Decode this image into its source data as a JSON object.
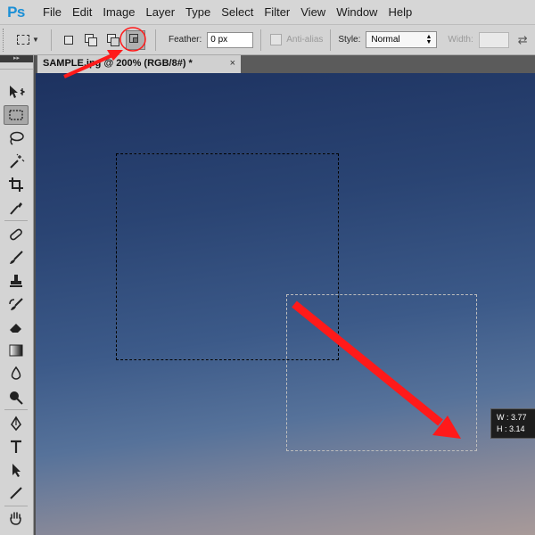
{
  "app": {
    "logo": "Ps"
  },
  "menu": [
    "File",
    "Edit",
    "Image",
    "Layer",
    "Type",
    "Select",
    "Filter",
    "View",
    "Window",
    "Help"
  ],
  "options": {
    "preset_icon": "rectangular-marquee-icon",
    "mode_buttons": [
      "new-selection-icon",
      "add-to-selection-icon",
      "subtract-from-selection-icon",
      "intersect-with-selection-icon"
    ],
    "active_mode": "intersect-with-selection-icon",
    "feather_label": "Feather:",
    "feather_value": "0 px",
    "antialias_label": "Anti-alias",
    "style_label": "Style:",
    "style_value": "Normal",
    "width_label": "Width:"
  },
  "document": {
    "tab_title": "SAMPLE.jpg @ 200% (RGB/8#) *",
    "close_glyph": "×"
  },
  "tooltip": {
    "w": "W :  3.77",
    "h": "H :  3.14"
  },
  "tools": [
    "move-icon",
    "rectangular-marquee-icon",
    "lasso-icon",
    "magic-wand-icon",
    "crop-icon",
    "eyedropper-icon",
    "healing-brush-icon",
    "brush-icon",
    "clone-stamp-icon",
    "history-brush-icon",
    "eraser-icon",
    "gradient-icon",
    "blur-icon",
    "dodge-icon",
    "pen-icon",
    "type-icon",
    "path-selection-icon",
    "line-icon",
    "hand-icon"
  ],
  "colors": {
    "annotation": "#ff1a1a",
    "logo": "#1b8fd6"
  }
}
